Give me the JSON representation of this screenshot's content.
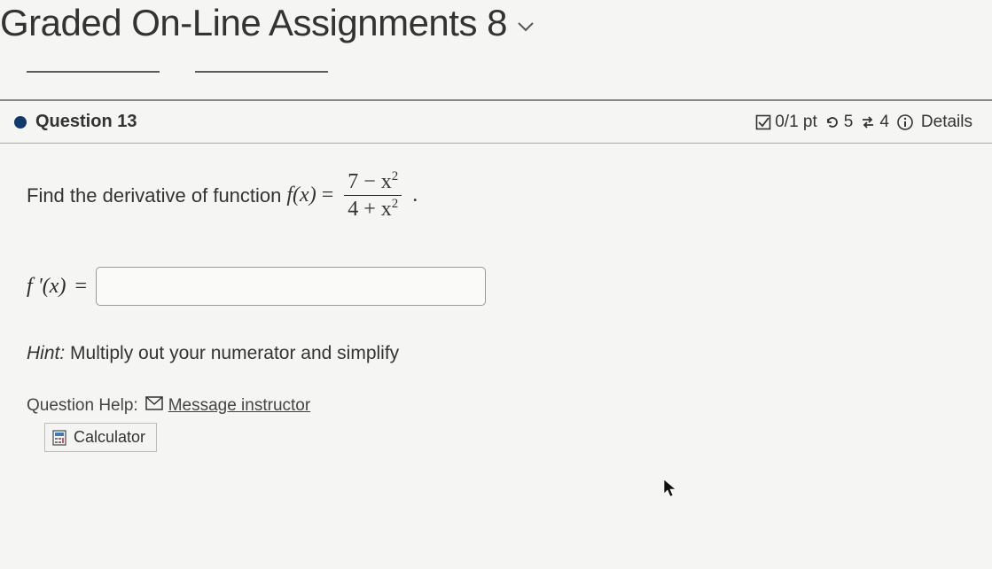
{
  "header": {
    "title": "Graded On-Line Assignments 8"
  },
  "question": {
    "label": "Question 13",
    "score": "0/1 pt",
    "attempts_remaining": "5",
    "retries": "4",
    "details_label": "Details"
  },
  "problem": {
    "prompt_prefix": "Find the derivative of function ",
    "fx": "f(x)",
    "equals": " = ",
    "numerator": "7 − x",
    "num_exp": "2",
    "denominator": "4 + x",
    "den_exp": "2",
    "period": "."
  },
  "answer": {
    "label_fpx": "f '(x)",
    "equals": " = ",
    "value": ""
  },
  "hint": {
    "label": "Hint:",
    "text": " Multiply out your numerator and simplify"
  },
  "help": {
    "label": "Question Help:",
    "message_link": "Message instructor",
    "calculator_label": "Calculator"
  }
}
